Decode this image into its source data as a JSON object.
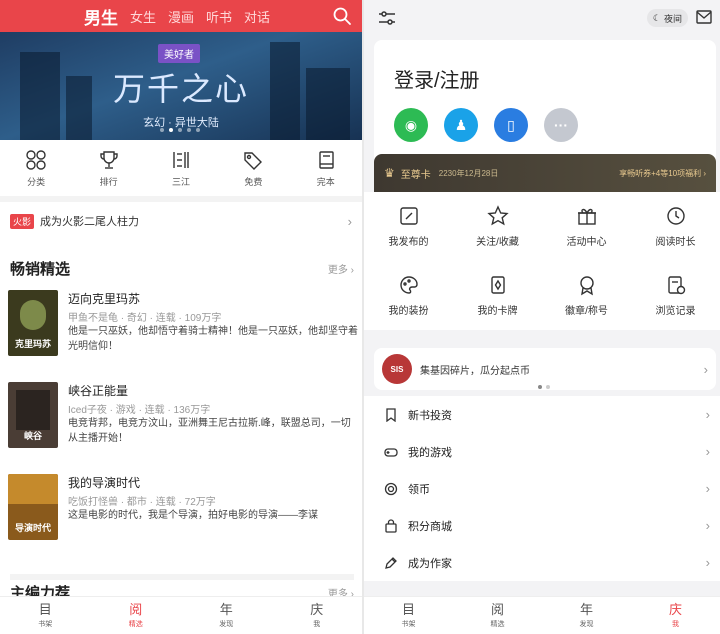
{
  "left": {
    "topnav": {
      "tabs": [
        {
          "label": "男生",
          "active": true
        },
        {
          "label": "女生",
          "active": false
        },
        {
          "label": "漫画",
          "active": false
        },
        {
          "label": "听书",
          "active": false
        },
        {
          "label": "对话",
          "active": false
        }
      ]
    },
    "banner": {
      "tag": "美好者",
      "title": "万千之心",
      "subtitle": "玄幻 · 异世大陆",
      "dots": 5,
      "active_dot": 1
    },
    "quick_links": [
      {
        "label": "分类",
        "icon": "grid-circles-icon"
      },
      {
        "label": "排行",
        "icon": "trophy-icon"
      },
      {
        "label": "三江",
        "icon": "sanjiang-icon"
      },
      {
        "label": "免费",
        "icon": "tag-icon"
      },
      {
        "label": "完本",
        "icon": "book-icon"
      }
    ],
    "notice": {
      "badge": "火影",
      "text": "成为火影二尾人柱力"
    },
    "bestseller": {
      "title": "畅销精选",
      "more": "更多",
      "books": [
        {
          "title": "迈向克里玛苏",
          "meta": "甲鱼不是龟 · 奇幻 · 连载 · 109万字",
          "desc": "他是一只巫妖，他却悟守着骑士精神！他是一只巫妖，他却坚守着光明信仰！",
          "cover_text": "克里玛苏",
          "cover_color": "#3b3a1e"
        },
        {
          "title": "峡谷正能量",
          "meta": "Iced子夜 · 游戏 · 连载 · 136万字",
          "desc": "电竞背邦，电竞方汶山，亚洲舞王尼古拉斯.峰，联盟总司，一切从主播开始！",
          "cover_text": "峡谷",
          "cover_color": "#4a3d35"
        },
        {
          "title": "我的导演时代",
          "meta": "吃饭打怪兽 · 都市 · 连载 · 72万字",
          "desc": "这是电影的时代，我是个导演，拍好电影的导演——李谋",
          "cover_text": "导演时代",
          "cover_color": "#8a5a1c"
        }
      ]
    },
    "editor_pick": {
      "title": "主编力荐",
      "more": "更多"
    },
    "bottombar": [
      {
        "glyph": "目",
        "label": "书架",
        "active": false
      },
      {
        "glyph": "阅",
        "label": "精选",
        "active": true
      },
      {
        "glyph": "年",
        "label": "发现",
        "active": false
      },
      {
        "glyph": "庆",
        "label": "我",
        "active": false
      }
    ]
  },
  "right": {
    "night_label": "夜间",
    "login_label": "登录/注册",
    "socials": [
      {
        "name": "wechat",
        "color": "#2dbb54",
        "glyph": "◉"
      },
      {
        "name": "qq",
        "color": "#1aa2e8",
        "glyph": "♟"
      },
      {
        "name": "phone",
        "color": "#2a7de1",
        "glyph": "▯"
      },
      {
        "name": "more",
        "color": "#c4c8d0",
        "glyph": "···"
      }
    ],
    "vip": {
      "title": "至尊卡",
      "date": "2230年12月28日",
      "right": "享畅听券+4等10项福利 ›"
    },
    "grid": [
      {
        "label": "我发布的",
        "icon": "edit-icon"
      },
      {
        "label": "关注/收藏",
        "icon": "star-icon"
      },
      {
        "label": "活动中心",
        "icon": "gift-icon"
      },
      {
        "label": "阅读时长",
        "icon": "clock-icon"
      },
      {
        "label": "我的装扮",
        "icon": "palette-icon"
      },
      {
        "label": "我的卡牌",
        "icon": "card-icon"
      },
      {
        "label": "徽章/称号",
        "icon": "badge-icon"
      },
      {
        "label": "浏览记录",
        "icon": "history-icon"
      }
    ],
    "promo": {
      "logo_text": "SIS",
      "text": "集基因碎片，瓜分起点币"
    },
    "menu": [
      {
        "label": "新书投资",
        "icon": "bookmark-icon"
      },
      {
        "label": "我的游戏",
        "icon": "gamepad-icon"
      },
      {
        "label": "领币",
        "icon": "coin-icon"
      },
      {
        "label": "积分商城",
        "icon": "shop-icon"
      },
      {
        "label": "成为作家",
        "icon": "pen-icon"
      }
    ],
    "bottombar": [
      {
        "glyph": "目",
        "label": "书架",
        "active": false
      },
      {
        "glyph": "阅",
        "label": "精选",
        "active": false
      },
      {
        "glyph": "年",
        "label": "发现",
        "active": false
      },
      {
        "glyph": "庆",
        "label": "我",
        "active": true
      }
    ]
  }
}
